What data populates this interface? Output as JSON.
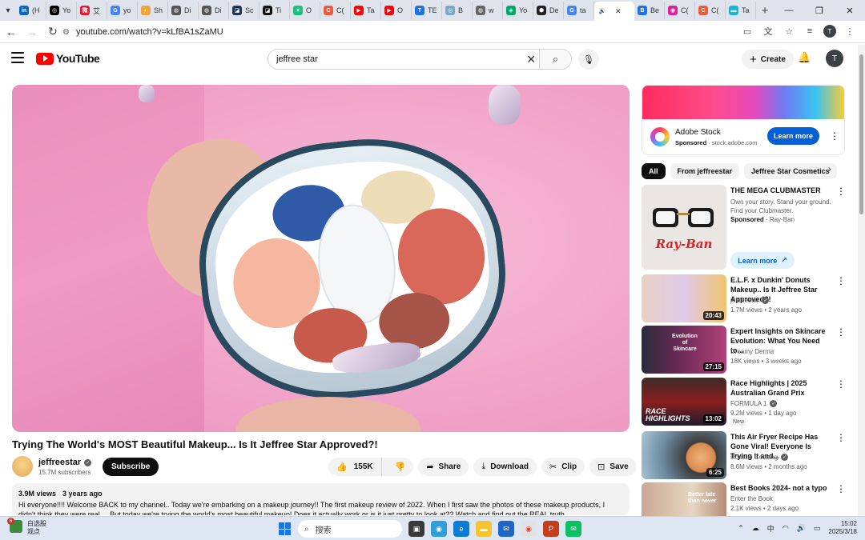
{
  "browser": {
    "tabs": [
      {
        "label": "(H",
        "color": "#0a66c2",
        "glyph": "in"
      },
      {
        "label": "Yo",
        "color": "#000000",
        "glyph": "◎"
      },
      {
        "label": "艾",
        "color": "#e6162d",
        "glyph": "微"
      },
      {
        "label": "yo",
        "color": "#4285f4",
        "glyph": "G"
      },
      {
        "label": "Sh",
        "color": "#f2a33a",
        "glyph": "◐"
      },
      {
        "label": "Di",
        "color": "#555555",
        "glyph": "◍"
      },
      {
        "label": "Di",
        "color": "#555555",
        "glyph": "◍"
      },
      {
        "label": "Sc",
        "color": "#1d3557",
        "glyph": "◪"
      },
      {
        "label": "Ti",
        "color": "#111111",
        "glyph": "◪"
      },
      {
        "label": "O",
        "color": "#19c37d",
        "glyph": "✦"
      },
      {
        "label": "C(",
        "color": "#ef5b3a",
        "glyph": "C"
      },
      {
        "label": "Ta",
        "color": "#ff0000",
        "glyph": "▶"
      },
      {
        "label": "O",
        "color": "#ff0000",
        "glyph": "▶"
      },
      {
        "label": "TE",
        "color": "#1a73e8",
        "glyph": "T"
      },
      {
        "label": "B",
        "color": "#7aa7c7",
        "glyph": "◎"
      },
      {
        "label": "w",
        "color": "#666666",
        "glyph": "◍"
      },
      {
        "label": "Yo",
        "color": "#00a86b",
        "glyph": "◈"
      },
      {
        "label": "De",
        "color": "#222222",
        "glyph": "⬢"
      },
      {
        "label": "ta",
        "color": "#4285f4",
        "glyph": "G"
      }
    ],
    "active_tab": {
      "label": "",
      "glyph": "🔊"
    },
    "tabs_after": [
      {
        "label": "Be",
        "color": "#1a73e8",
        "glyph": "B"
      },
      {
        "label": "C(",
        "color": "#d6249f",
        "glyph": "◉"
      },
      {
        "label": "C(",
        "color": "#ef5b3a",
        "glyph": "C"
      },
      {
        "label": "Ta",
        "color": "#19b5d8",
        "glyph": "▬"
      }
    ],
    "url": "youtube.com/watch?v=kLfBA1sZaMU",
    "profile_initial": "T"
  },
  "header": {
    "logo_text": "YouTube",
    "search_value": "jeffree star",
    "create_label": "Create",
    "avatar_initial": "T"
  },
  "video": {
    "title": "Trying The World's MOST Beautiful Makeup... Is It Jeffree Star Approved?!",
    "channel": "jeffreestar",
    "subscribers": "15.7M subscribers",
    "subscribe_label": "Subscribe",
    "likes": "155K",
    "share_label": "Share",
    "download_label": "Download",
    "clip_label": "Clip",
    "save_label": "Save",
    "views": "3.9M views",
    "age": "3 years ago",
    "description": "Hi everyone!!!! Welcome BACK to my channel.. Today we're embarking on a makeup journey!! The first makeup review of 2022. When I first saw the photos of these makeup products, I didn't think they were real.... But today we're trying the world's most beautiful makeup! Does it actually work or is it just pretty to look at?? Watch and find out the REAL truth..."
  },
  "sidebar": {
    "ad": {
      "title": "Adobe Stock",
      "sponsored": "Sponsored",
      "domain": "stock.adobe.com",
      "cta": "Learn more"
    },
    "chips": [
      "All",
      "From jeffreestar",
      "Jeffree Star Cosmetics"
    ],
    "rayban": {
      "title": "THE MEGA CLUBMASTER",
      "desc": "Own your story. Stand your ground. Find your Clubmaster.",
      "sponsored": "Sponsored",
      "advertiser": "Ray-Ban",
      "cta": "Learn more",
      "logo": "Ray-Ban"
    },
    "recs": [
      {
        "title": "E.L.F. x Dunkin' Donuts Makeup.. Is It Jeffree Star Approved?!",
        "channel": "jeffreestar",
        "meta": "1.7M views • 2 years ago",
        "duration": "20:43",
        "thumb": "#d9c4e6",
        "thumb_text": ""
      },
      {
        "title": "Expert Insights on Skincare Evolution: What You Need to...",
        "channel": "Dreamy Derma",
        "meta": "18K views • 3 weeks ago",
        "duration": "27:15",
        "thumb": "#7a2d5c",
        "thumb_text": "Evolution of Skincare"
      },
      {
        "title": "Race Highlights | 2025 Australian Grand Prix",
        "channel": "FORMULA 1",
        "meta": "9.2M views • 1 day ago",
        "duration": "13:02",
        "badge": "New",
        "thumb": "#1b1b2b",
        "thumb_text": "RACE HIGHLIGHTS"
      },
      {
        "title": "This Air Fryer Recipe Has Gone Viral! Everyone Is Trying It and...",
        "channel": "Rosario Cooking",
        "meta": "8.6M views • 2 months ago",
        "duration": "6:25",
        "thumb": "#9cc4d6",
        "thumb_text": ""
      },
      {
        "title": "Best Books 2024- not a typo",
        "channel": "Enter the Book",
        "meta": "2.1K views • 2 days ago",
        "duration": "",
        "thumb": "#d2c7b5",
        "thumb_text": "Better late than never"
      }
    ]
  },
  "taskbar": {
    "weather_badge": "6",
    "weather_label": "白选股",
    "weather_sub": "观点",
    "search_placeholder": "搜索",
    "ime": "中",
    "time": "15:02",
    "date": "2025/3/18"
  }
}
